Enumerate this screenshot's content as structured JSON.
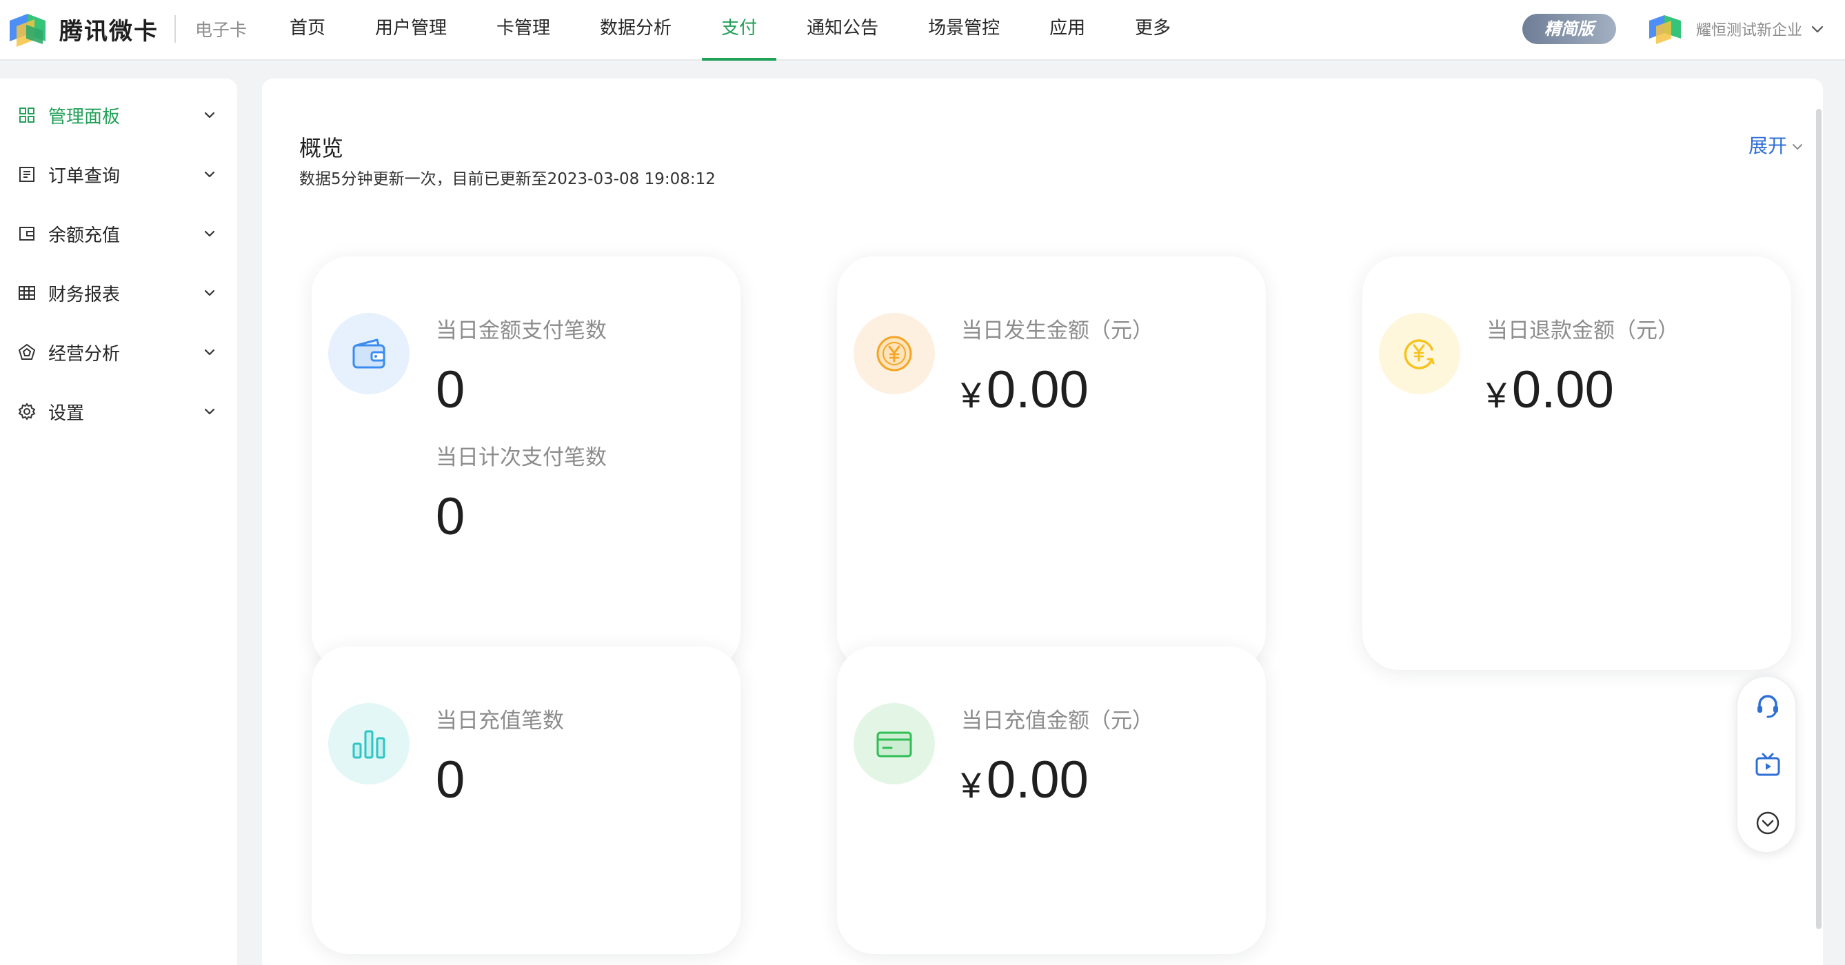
{
  "header": {
    "brand": "腾讯微卡",
    "product": "电子卡",
    "nav": [
      {
        "label": "首页",
        "active": false
      },
      {
        "label": "用户管理",
        "active": false
      },
      {
        "label": "卡管理",
        "active": false
      },
      {
        "label": "数据分析",
        "active": false
      },
      {
        "label": "支付",
        "active": true
      },
      {
        "label": "通知公告",
        "active": false
      },
      {
        "label": "场景管控",
        "active": false
      },
      {
        "label": "应用",
        "active": false
      },
      {
        "label": "更多",
        "active": false
      }
    ],
    "edition_badge": "精简版",
    "company": "耀恒测试新企业"
  },
  "sidebar": {
    "items": [
      {
        "label": "管理面板",
        "icon": "dashboard-grid-icon",
        "active": true
      },
      {
        "label": "订单查询",
        "icon": "order-list-icon",
        "active": false
      },
      {
        "label": "余额充值",
        "icon": "wallet-icon",
        "active": false
      },
      {
        "label": "财务报表",
        "icon": "table-icon",
        "active": false
      },
      {
        "label": "经营分析",
        "icon": "analysis-pentagon-icon",
        "active": false
      },
      {
        "label": "设置",
        "icon": "gear-icon",
        "active": false
      }
    ]
  },
  "overview": {
    "title": "概览",
    "subtitle": "数据5分钟更新一次，目前已更新至2023-03-08 19:08:12",
    "expand_label": "展开"
  },
  "cards": {
    "amount_payments": {
      "label": "当日金额支付笔数",
      "value": "0",
      "icon": "wallet-icon"
    },
    "count_payments": {
      "label": "当日计次支付笔数",
      "value": "0"
    },
    "daily_amount": {
      "label": "当日发生金额（元）",
      "currency": "¥",
      "value": "0.00",
      "icon": "yen-coin-icon"
    },
    "daily_refund": {
      "label": "当日退款金额（元）",
      "currency": "¥",
      "value": "0.00",
      "icon": "yen-refund-icon"
    },
    "recharge_count": {
      "label": "当日充值笔数",
      "value": "0",
      "icon": "bar-chart-icon"
    },
    "recharge_amount": {
      "label": "当日充值金额（元）",
      "currency": "¥",
      "value": "0.00",
      "icon": "card-icon"
    }
  },
  "colors": {
    "accent_green": "#21a058",
    "link_blue": "#2f6fd6",
    "icon_blue": "#3b8cf0",
    "icon_orange": "#f5a524",
    "icon_yellow": "#f7c21e",
    "icon_teal": "#2ec5c5",
    "icon_green": "#2fbf55"
  }
}
